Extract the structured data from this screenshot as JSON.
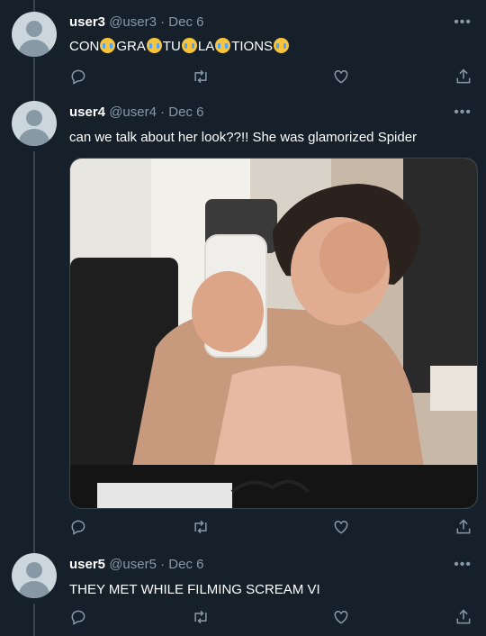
{
  "tweets": [
    {
      "name": "user3",
      "handle": "@user3",
      "date": "Dec 6",
      "text_parts": [
        "CON",
        "GRA",
        "TU",
        "LA",
        "TIONS"
      ],
      "emoji": "loudly-crying-face"
    },
    {
      "name": "user4",
      "handle": "@user4",
      "date": "Dec 6",
      "text": "can we talk about her look??!! She was glamorized Spider"
    },
    {
      "name": "user5",
      "handle": "@user5",
      "date": "Dec 6",
      "text": "THEY MET WHILE FILMING SCREAM VI"
    }
  ],
  "separator": "·",
  "more_glyph": "•••",
  "icons": {
    "reply": "reply-icon",
    "retweet": "retweet-icon",
    "like": "heart-icon",
    "share": "share-icon"
  },
  "colors": {
    "background": "#15202b",
    "secondary_text": "#8899a6",
    "avatar_bg": "#ccd6dd"
  }
}
